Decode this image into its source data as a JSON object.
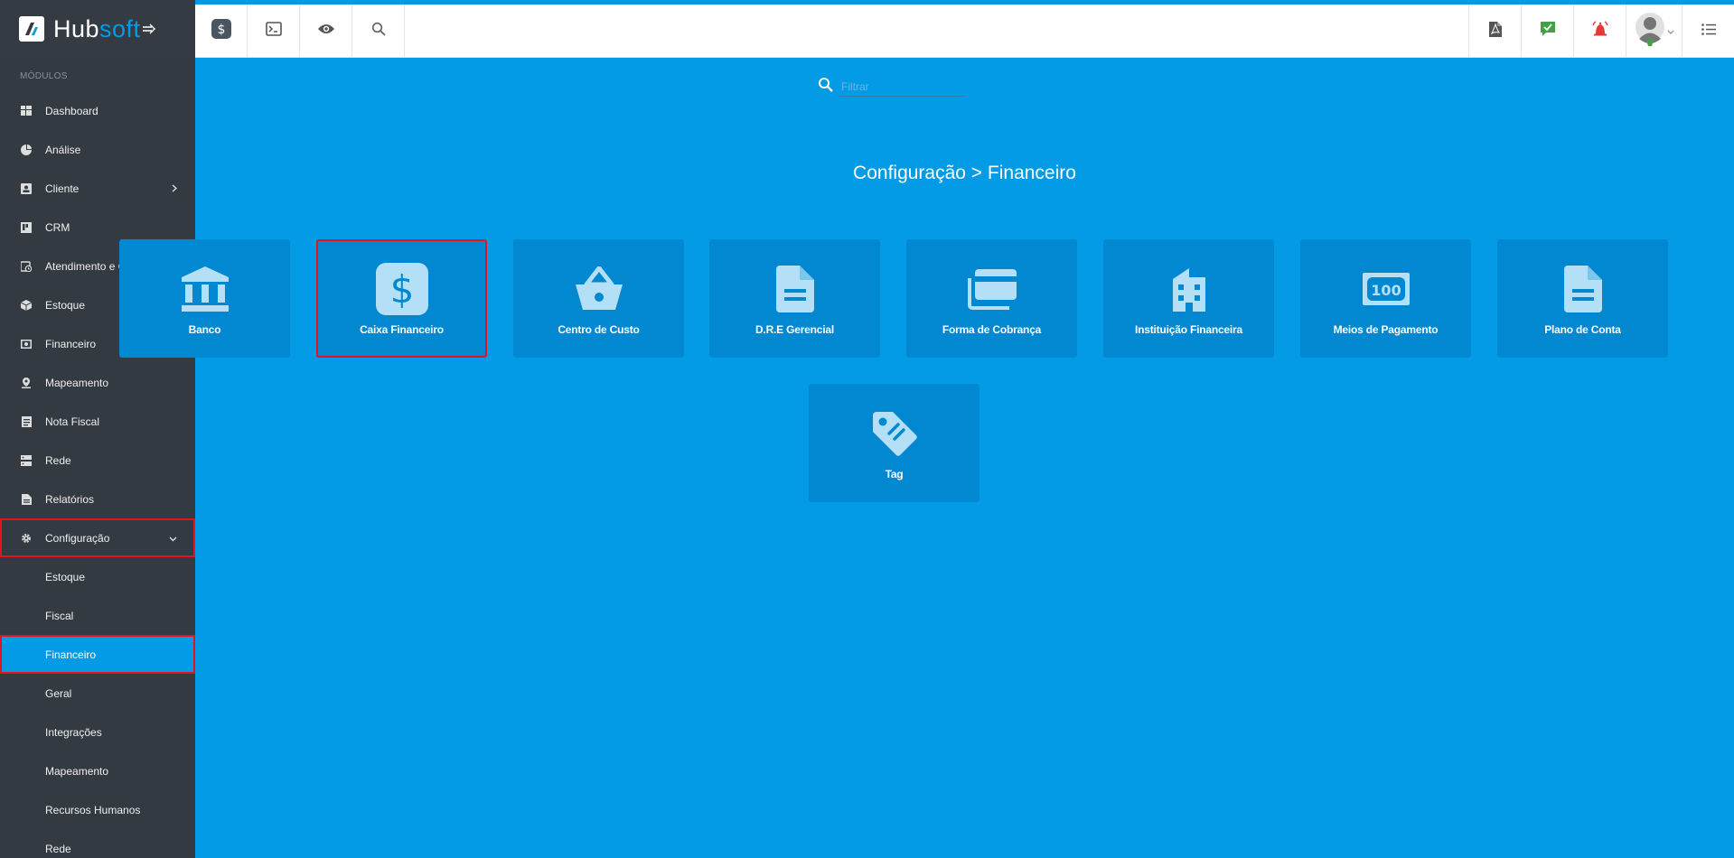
{
  "brand": {
    "name_a": "Hub",
    "name_b": "soft"
  },
  "sidebar": {
    "section_title": "MÓDULOS",
    "items": [
      {
        "label": "Dashboard"
      },
      {
        "label": "Análise"
      },
      {
        "label": "Cliente"
      },
      {
        "label": "CRM"
      },
      {
        "label": "Atendimento e OS"
      },
      {
        "label": "Estoque"
      },
      {
        "label": "Financeiro"
      },
      {
        "label": "Mapeamento"
      },
      {
        "label": "Nota Fiscal"
      },
      {
        "label": "Rede"
      },
      {
        "label": "Relatórios"
      },
      {
        "label": "Configuração"
      }
    ],
    "sub_items": [
      {
        "label": "Estoque"
      },
      {
        "label": "Fiscal"
      },
      {
        "label": "Financeiro"
      },
      {
        "label": "Geral"
      },
      {
        "label": "Integrações"
      },
      {
        "label": "Mapeamento"
      },
      {
        "label": "Recursos Humanos"
      },
      {
        "label": "Rede"
      }
    ]
  },
  "search": {
    "placeholder": "Filtrar"
  },
  "page": {
    "title": "Configuração > Financeiro"
  },
  "cards": [
    {
      "label": "Banco",
      "icon": "bank-icon"
    },
    {
      "label": "Caixa Financeiro",
      "icon": "dollar-icon"
    },
    {
      "label": "Centro de Custo",
      "icon": "basket-icon"
    },
    {
      "label": "D.R.E Gerencial",
      "icon": "document-icon"
    },
    {
      "label": "Forma de Cobrança",
      "icon": "cards-icon"
    },
    {
      "label": "Instituição Financeira",
      "icon": "building-icon"
    },
    {
      "label": "Meios de Pagamento",
      "icon": "money-icon"
    },
    {
      "label": "Plano de Conta",
      "icon": "document-icon"
    },
    {
      "label": "Tag",
      "icon": "tag-icon"
    }
  ],
  "colors": {
    "accent": "#039be5",
    "sidebar": "#333a41",
    "card": "#0288d1",
    "highlight": "#e3141b"
  }
}
